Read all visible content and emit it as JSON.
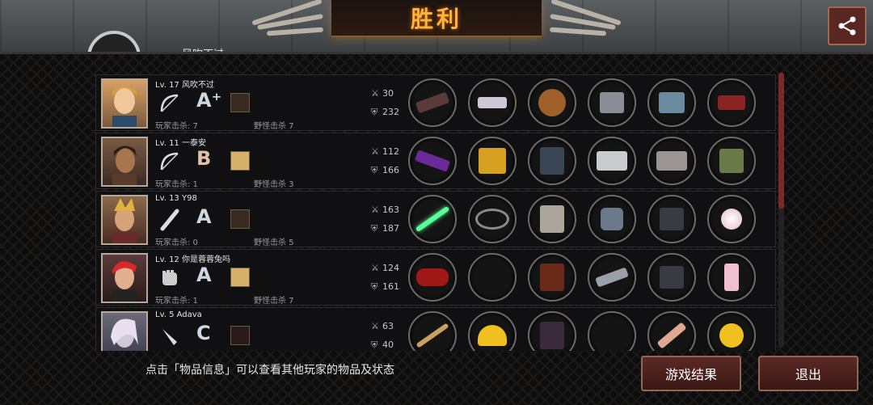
{
  "header": {
    "title": "胜利",
    "peek_name": "风吹不过"
  },
  "hint": "点击「物品信息」可以查看其他玩家的物品及状态",
  "buttons": {
    "results": "游戏结果",
    "exit": "退出"
  },
  "players": [
    {
      "level_name": "Lv. 17 风吹不过",
      "weapon": "bow",
      "grade": "A⁺",
      "player_kills": "玩家击杀: 7",
      "monster_kills": "野怪击杀 7",
      "attack": "30",
      "defense": "232"
    },
    {
      "level_name": "Lv. 11 一泰安",
      "weapon": "bow",
      "grade": "B",
      "player_kills": "玩家击杀: 1",
      "monster_kills": "野怪击杀 3",
      "attack": "112",
      "defense": "166"
    },
    {
      "level_name": "Lv. 13 Y98",
      "weapon": "bat",
      "grade": "A",
      "player_kills": "玩家击杀: 0",
      "monster_kills": "野怪击杀 5",
      "attack": "163",
      "defense": "187"
    },
    {
      "level_name": "Lv. 12 你是蓉蓉兔吗",
      "weapon": "glove",
      "grade": "A",
      "player_kills": "玩家击杀: 1",
      "monster_kills": "野怪击杀 7",
      "attack": "124",
      "defense": "161"
    },
    {
      "level_name": "Lv. 5 Adava",
      "weapon": "knife",
      "grade": "C",
      "player_kills": "",
      "monster_kills": "",
      "attack": "63",
      "defense": "40"
    }
  ],
  "colors": {
    "accent": "#ffb23c",
    "button_bg": "#5b2a25",
    "scroll": "#7a2a24"
  }
}
